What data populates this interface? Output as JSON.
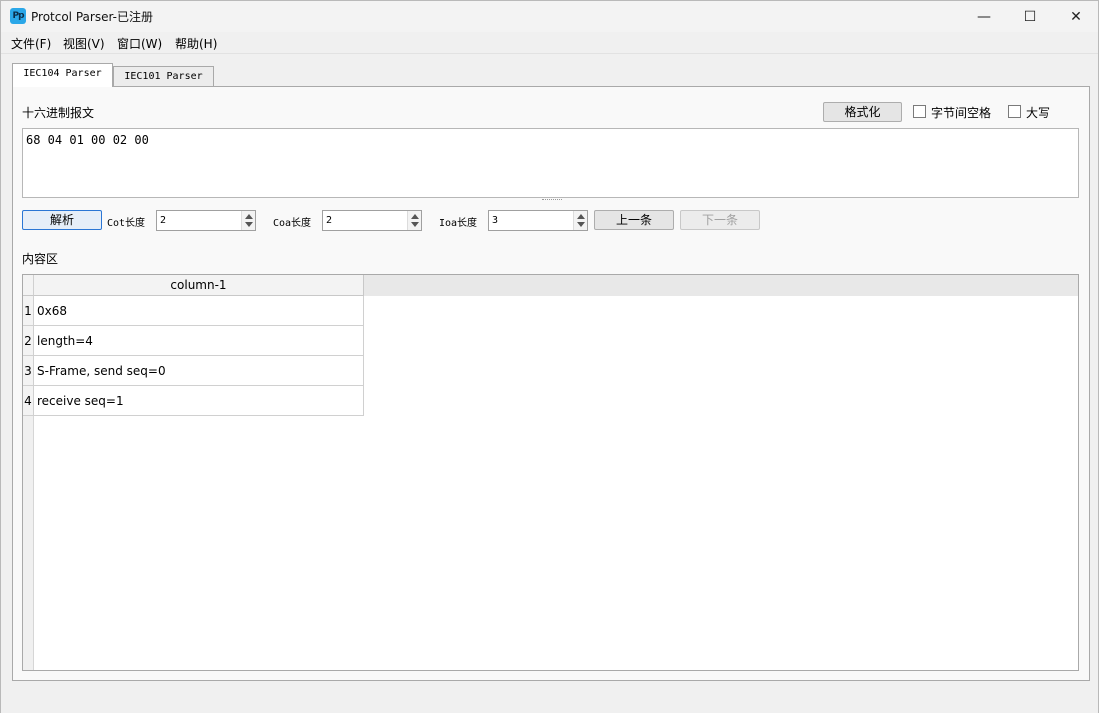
{
  "window": {
    "title": "Protcol Parser-已注册",
    "icon_text": "Pp",
    "controls": {
      "minimize": "—",
      "maximize": "☐",
      "close": "✕"
    }
  },
  "menu": [
    {
      "label": "文件(F)"
    },
    {
      "label": "视图(V)"
    },
    {
      "label": "窗口(W)"
    },
    {
      "label": "帮助(H)"
    }
  ],
  "tabs": [
    {
      "label": "IEC104 Parser",
      "active": true
    },
    {
      "label": "IEC101 Parser",
      "active": false
    }
  ],
  "hex_section": {
    "label": "十六进制报文",
    "format_button": "格式化",
    "byte_space_label": "字节间空格",
    "byte_space_checked": false,
    "uppercase_label": "大写",
    "uppercase_checked": false,
    "value": "68 04 01 00 02 00"
  },
  "controls": {
    "parse_button": "解析",
    "cot_label": "Cot长度",
    "cot_value": "2",
    "coa_label": "Coa长度",
    "coa_value": "2",
    "ioa_label": "Ioa长度",
    "ioa_value": "3",
    "prev_button": "上一条",
    "next_button": "下一条"
  },
  "content": {
    "label": "内容区",
    "column_header": "column-1",
    "rows": [
      {
        "num": "1",
        "value": "0x68"
      },
      {
        "num": "2",
        "value": "length=4"
      },
      {
        "num": "3",
        "value": "S-Frame, send seq=0"
      },
      {
        "num": "4",
        "value": "receive seq=1"
      }
    ]
  }
}
